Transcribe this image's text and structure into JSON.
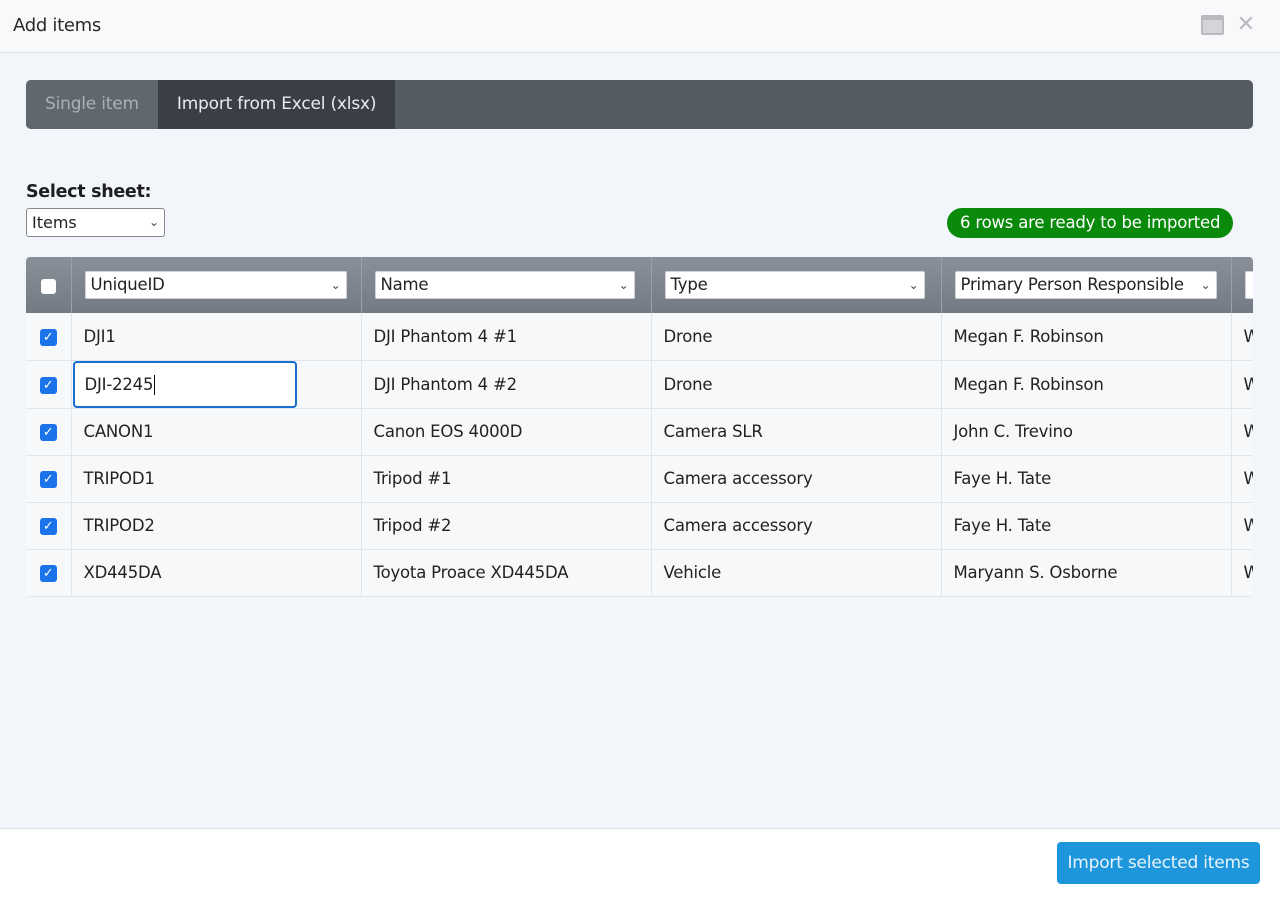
{
  "dialog": {
    "title": "Add items",
    "icons": {
      "minimize": "window-minimize-icon",
      "close": "close-icon"
    },
    "close_glyph": "✕"
  },
  "tabs": [
    {
      "label": "Single item",
      "active": false
    },
    {
      "label": "Import from Excel (xlsx)",
      "active": true
    }
  ],
  "sheet": {
    "label": "Select sheet:",
    "selected": "Items",
    "chevron": "⌄"
  },
  "status_badge": {
    "text": "6 rows are ready to be imported",
    "color": "#0a8a0a"
  },
  "table": {
    "select_all_checked": false,
    "columns": [
      {
        "mapping": "UniqueID"
      },
      {
        "mapping": "Name"
      },
      {
        "mapping": "Type"
      },
      {
        "mapping": "Primary Person Responsible"
      },
      {
        "mapping": ""
      }
    ],
    "rows": [
      {
        "checked": true,
        "cells": [
          "DJI1",
          "DJI Phantom 4 #1",
          "Drone",
          "Megan F. Robinson",
          "W"
        ]
      },
      {
        "checked": true,
        "cells": [
          "DJI-2245",
          "DJI Phantom 4 #2",
          "Drone",
          "Megan F. Robinson",
          "W"
        ],
        "editing_cell": 0
      },
      {
        "checked": true,
        "cells": [
          "CANON1",
          "Canon EOS 4000D",
          "Camera SLR",
          "John C. Trevino",
          "W"
        ]
      },
      {
        "checked": true,
        "cells": [
          "TRIPOD1",
          "Tripod #1",
          "Camera accessory",
          "Faye H. Tate",
          "W"
        ]
      },
      {
        "checked": true,
        "cells": [
          "TRIPOD2",
          "Tripod #2",
          "Camera accessory",
          "Faye H. Tate",
          "W"
        ]
      },
      {
        "checked": true,
        "cells": [
          "XD445DA",
          "Toyota Proace XD445DA",
          "Vehicle",
          "Maryann S. Osborne",
          "W"
        ]
      }
    ]
  },
  "footer": {
    "import_button": "Import selected items",
    "accent": "#1e96dc"
  },
  "checkmark_glyph": "✓"
}
